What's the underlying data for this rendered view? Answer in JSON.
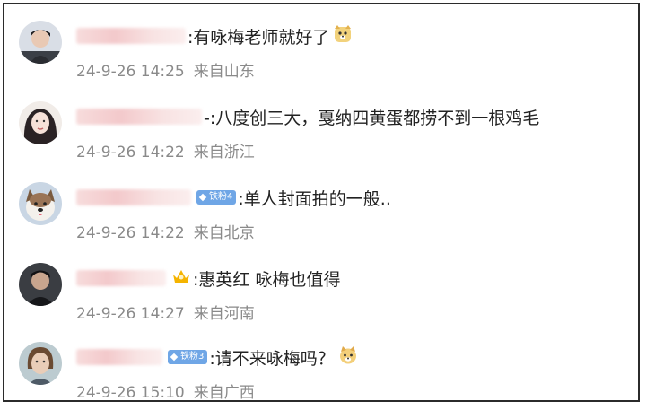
{
  "comments": [
    {
      "text": ":有咏梅老师就好了",
      "date": "24-9-26 14:25",
      "location": "来自山东",
      "emoji": "dog-emoji"
    },
    {
      "text": "-:八度创三大，戛纳四黄蛋都捞不到一根鸡毛",
      "date": "24-9-26 14:22",
      "location": "来自浙江"
    },
    {
      "text": ":单人封面拍的一般..",
      "date": "24-9-26 14:22",
      "location": "来自北京",
      "fan_badge": "铁粉4"
    },
    {
      "text": ":惠英红 咏梅也值得",
      "date": "24-9-26 14:27",
      "location": "来自河南",
      "badge_icon": "crown-icon"
    },
    {
      "text": ":请不来咏梅吗？",
      "date": "24-9-26 15:10",
      "location": "来自广西",
      "fan_badge": "铁粉3",
      "emoji": "doge-emoji"
    }
  ],
  "colors": {
    "text": "#222222",
    "meta": "#8a8a8a",
    "fan_badge": "#6fa6e6",
    "crown": "#f5b400"
  }
}
